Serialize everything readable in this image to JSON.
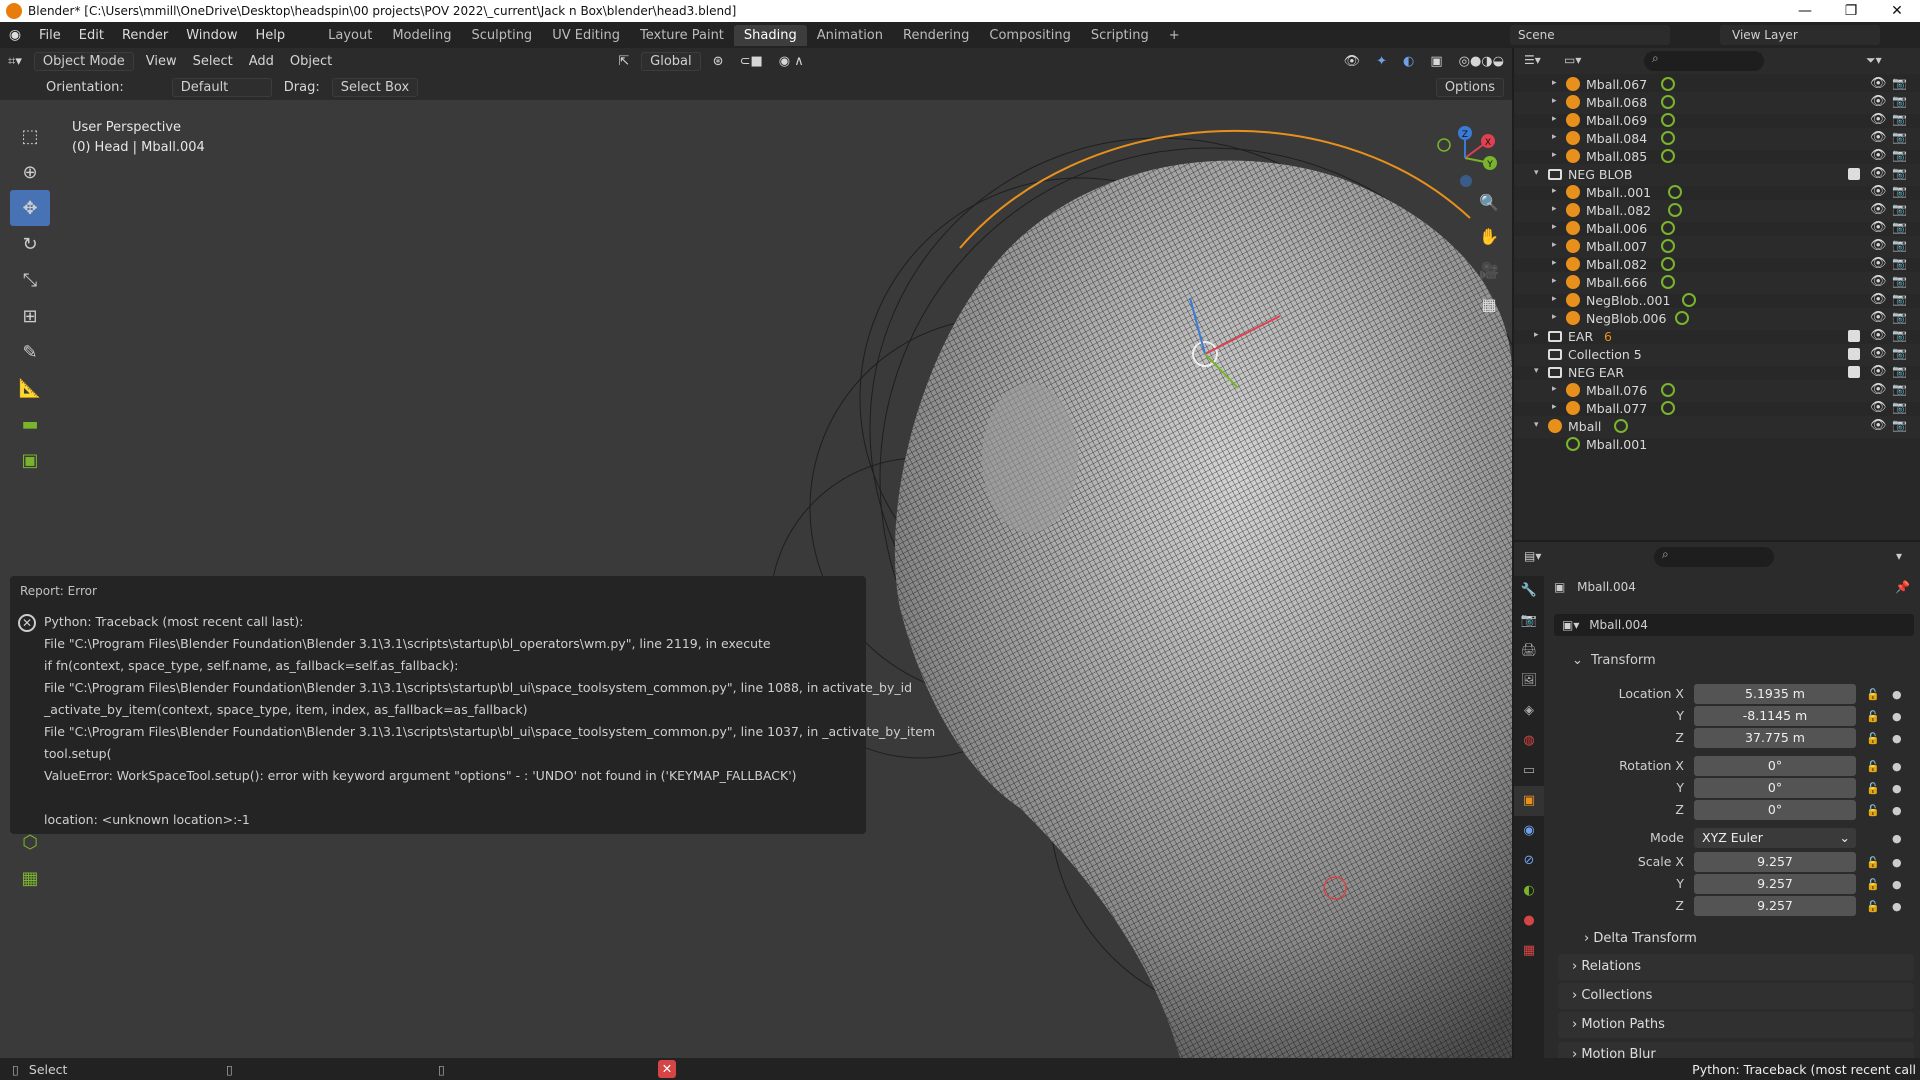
{
  "titlebar": {
    "title": "Blender* [C:\\Users\\mmill\\OneDrive\\Desktop\\headspin\\00 projects\\POV 2022\\_current\\Jack n Box\\blender\\head3.blend]",
    "minimize": "—",
    "maximize": "❐",
    "close": "✕"
  },
  "menu": [
    "File",
    "Edit",
    "Render",
    "Window",
    "Help"
  ],
  "workspaces": [
    "Layout",
    "Modeling",
    "Sculpting",
    "UV Editing",
    "Texture Paint",
    "Shading",
    "Animation",
    "Rendering",
    "Compositing",
    "Scripting",
    "+"
  ],
  "active_workspace": "Shading",
  "scene": {
    "name": "Scene",
    "view_layer": "View Layer"
  },
  "viewport": {
    "mode": "Object Mode",
    "menus": [
      "View",
      "Select",
      "Add",
      "Object"
    ],
    "transform_orientation": "Global",
    "options_label": "Options",
    "tool_settings": {
      "orientation_label": "Orientation:",
      "orientation_value": "Default",
      "drag_label": "Drag:",
      "drag_value": "Select Box"
    },
    "info_line1": "User Perspective",
    "info_line2": "(0) Head | Mball.004",
    "gizmo_axes": [
      "X",
      "Y",
      "Z"
    ]
  },
  "report": {
    "title": "Report: Error",
    "lines": [
      "Python: Traceback (most recent call last):",
      "  File \"C:\\Program Files\\Blender Foundation\\Blender 3.1\\3.1\\scripts\\startup\\bl_operators\\wm.py\", line 2119, in execute",
      "    if fn(context, space_type, self.name, as_fallback=self.as_fallback):",
      "  File \"C:\\Program Files\\Blender Foundation\\Blender 3.1\\3.1\\scripts\\startup\\bl_ui\\space_toolsystem_common.py\", line 1088, in activate_by_id",
      "    _activate_by_item(context, space_type, item, index, as_fallback=as_fallback)",
      "  File \"C:\\Program Files\\Blender Foundation\\Blender 3.1\\3.1\\scripts\\startup\\bl_ui\\space_toolsystem_common.py\", line 1037, in _activate_by_item",
      "    tool.setup(",
      "ValueError: WorkSpaceTool.setup(): error with keyword argument \"options\" - : 'UNDO' not found in ('KEYMAP_FALLBACK')",
      "",
      "location: <unknown location>:-1"
    ]
  },
  "outliner": {
    "rows": [
      {
        "label": "Mball.067",
        "indent": 2,
        "type": "mball",
        "tri": "▸"
      },
      {
        "label": "Mball.068",
        "indent": 2,
        "type": "mball",
        "tri": "▸"
      },
      {
        "label": "Mball.069",
        "indent": 2,
        "type": "mball",
        "tri": "▸"
      },
      {
        "label": "Mball.084",
        "indent": 2,
        "type": "mball",
        "tri": "▸"
      },
      {
        "label": "Mball.085",
        "indent": 2,
        "type": "mball",
        "tri": "▸"
      },
      {
        "label": "NEG BLOB",
        "indent": 1,
        "type": "collection",
        "tri": "▾"
      },
      {
        "label": "Mball..001",
        "indent": 2,
        "type": "mball",
        "tri": "▸"
      },
      {
        "label": "Mball..082",
        "indent": 2,
        "type": "mball",
        "tri": "▸"
      },
      {
        "label": "Mball.006",
        "indent": 2,
        "type": "mball",
        "tri": "▸"
      },
      {
        "label": "Mball.007",
        "indent": 2,
        "type": "mball",
        "tri": "▸"
      },
      {
        "label": "Mball.082",
        "indent": 2,
        "type": "mball",
        "tri": "▸"
      },
      {
        "label": "Mball.666",
        "indent": 2,
        "type": "mball",
        "tri": "▸"
      },
      {
        "label": "NegBlob..001",
        "indent": 2,
        "type": "mball",
        "tri": "▸"
      },
      {
        "label": "NegBlob.006",
        "indent": 2,
        "type": "mball",
        "tri": "▸"
      },
      {
        "label": "EAR",
        "indent": 1,
        "type": "collection",
        "tri": "▸",
        "badge": "6"
      },
      {
        "label": "Collection 5",
        "indent": 1,
        "type": "collection",
        "tri": ""
      },
      {
        "label": "NEG EAR",
        "indent": 1,
        "type": "collection",
        "tri": "▾"
      },
      {
        "label": "Mball.076",
        "indent": 2,
        "type": "mball",
        "tri": "▸"
      },
      {
        "label": "Mball.077",
        "indent": 2,
        "type": "mball",
        "tri": "▸"
      },
      {
        "label": "Mball",
        "indent": 1,
        "type": "mball",
        "tri": "▾"
      },
      {
        "label": "Mball.001",
        "indent": 2,
        "type": "data",
        "tri": ""
      }
    ]
  },
  "properties": {
    "object_name": "Mball.004",
    "object_field": "Mball.004",
    "transform_header": "Transform",
    "location": {
      "label_x": "Location X",
      "x": "5.1935 m",
      "y": "-8.1145 m",
      "z": "37.775 m"
    },
    "rotation": {
      "label_x": "Rotation X",
      "x": "0°",
      "y": "0°",
      "z": "0°"
    },
    "mode_label": "Mode",
    "mode_value": "XYZ Euler",
    "scale": {
      "label_x": "Scale X",
      "x": "9.257",
      "y": "9.257",
      "z": "9.257"
    },
    "axis_y": "Y",
    "axis_z": "Z",
    "sections": [
      "Delta Transform",
      "Relations",
      "Collections",
      "Motion Paths",
      "Motion Blur"
    ]
  },
  "statusbar": {
    "select": "Select",
    "message": "Python: Traceback (most recent call"
  },
  "colors": {
    "accent": "#4772b3",
    "selection_orange": "#e8901c",
    "error_red": "#d64545"
  }
}
